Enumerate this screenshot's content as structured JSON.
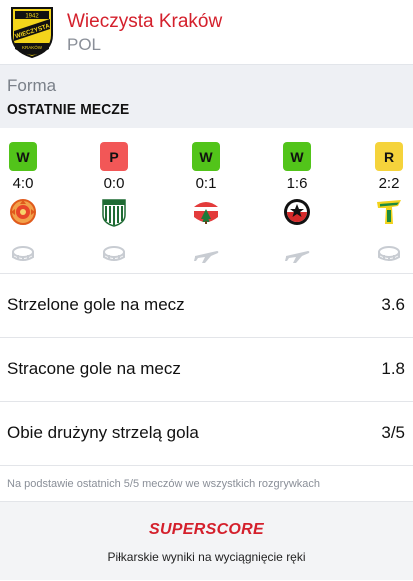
{
  "header": {
    "team_name": "Wieczysta Kraków",
    "country": "POL",
    "logo": {
      "year": "1942",
      "text": "WIECZYSTA",
      "sub": "KRAKÓW"
    }
  },
  "section": {
    "label": "Forma",
    "subtitle": "OSTATNIE MECZE"
  },
  "matches": [
    {
      "result": "W",
      "score": "4:0",
      "color": "#52c41a",
      "venue_icon": "stadium-icon"
    },
    {
      "result": "P",
      "score": "0:0",
      "color": "#f25757",
      "venue_icon": "stadium-icon"
    },
    {
      "result": "W",
      "score": "0:1",
      "color": "#52c41a",
      "venue_icon": "plane-icon"
    },
    {
      "result": "W",
      "score": "1:6",
      "color": "#52c41a",
      "venue_icon": "plane-icon"
    },
    {
      "result": "R",
      "score": "2:2",
      "color": "#f5d33b",
      "venue_icon": "stadium-icon"
    }
  ],
  "stats": [
    {
      "label": "Strzelone gole na mecz",
      "value": "3.6"
    },
    {
      "label": "Stracone gole na mecz",
      "value": "1.8"
    },
    {
      "label": "Obie drużyny strzelą gola",
      "value": "3/5"
    }
  ],
  "footnote": "Na podstawie ostatnich 5/5 meczów we wszystkich rozgrywkach",
  "promo": {
    "brand": "SUPERSCORE",
    "tagline": "Piłkarskie wyniki na wyciągnięcie ręki"
  },
  "colors": {
    "accent": "#d4202c",
    "win": "#52c41a",
    "loss": "#f25757",
    "draw": "#f5d33b"
  }
}
